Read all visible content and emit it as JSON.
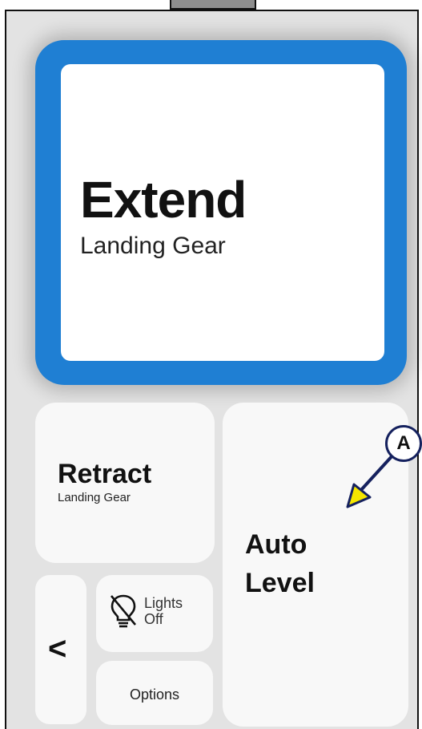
{
  "extend": {
    "title": "Extend",
    "subtitle": "Landing Gear"
  },
  "retract": {
    "title": "Retract",
    "subtitle": "Landing Gear"
  },
  "auto_level": {
    "line1": "Auto",
    "line2": "Level"
  },
  "back": {
    "icon": "chevron-left-icon",
    "glyph": "<"
  },
  "lights": {
    "icon": "lightbulb-off-icon",
    "line1": "Lights",
    "line2": "Off"
  },
  "options": {
    "label": "Options"
  },
  "callout": {
    "label": "A"
  },
  "colors": {
    "accent": "#1f7fd3",
    "arrow_fill": "#f5e600",
    "arrow_stroke": "#15215e"
  }
}
